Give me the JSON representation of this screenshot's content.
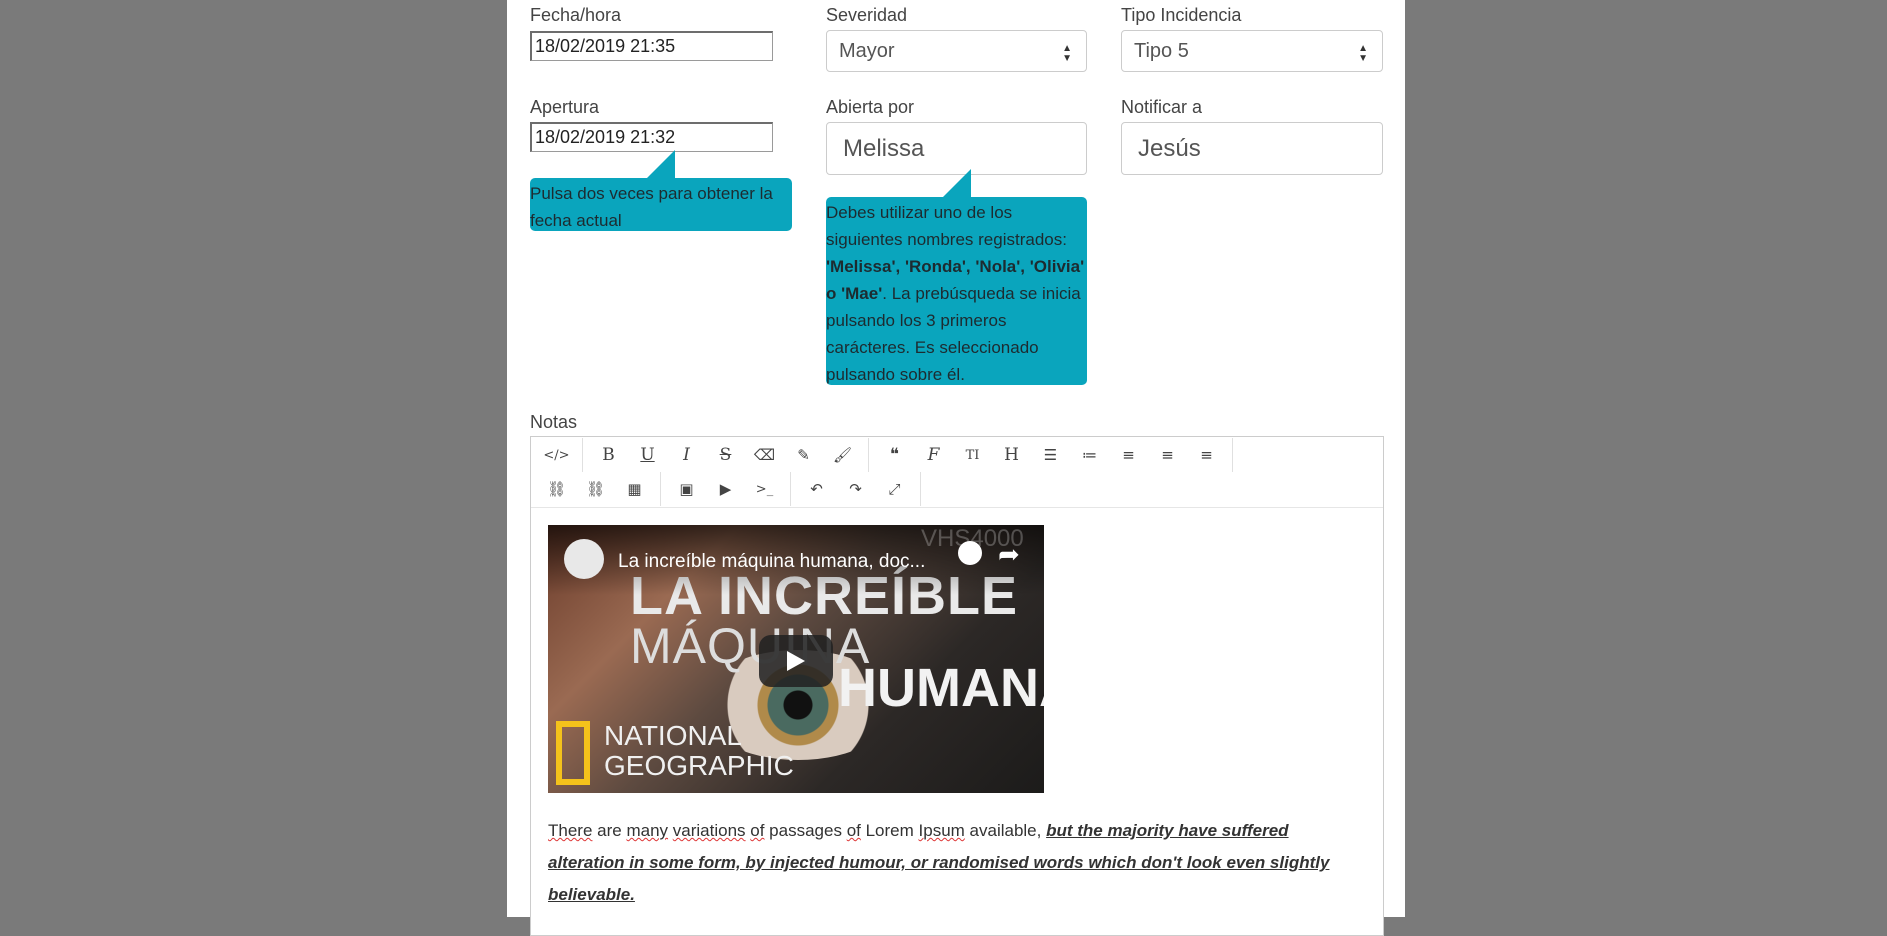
{
  "form": {
    "fecha": {
      "label": "Fecha/hora",
      "value": "18/02/2019 21:35"
    },
    "severidad": {
      "label": "Severidad",
      "value": "Mayor"
    },
    "tipo": {
      "label": "Tipo Incidencia",
      "value": "Tipo 5"
    },
    "apertura": {
      "label": "Apertura",
      "value": "18/02/2019 21:32"
    },
    "abierta_por": {
      "label": "Abierta por",
      "value": "Melissa"
    },
    "notificar": {
      "label": "Notificar a",
      "value": "Jesús"
    },
    "tooltip_apertura": "Pulsa dos veces para obtener la fecha actual",
    "tooltip_abierta": {
      "intro": "Debes utilizar uno de los siguientes nombres registrados:",
      "names": "'Melissa', 'Ronda', 'Nola', 'Olivia' o 'Mae'",
      "rest": ". La prebúsqueda se inicia pulsando los 3 primeros carácteres. Es seleccionado pulsando sobre él."
    },
    "notas_label": "Notas"
  },
  "toolbar": {
    "row1": [
      [
        "code-view-icon"
      ],
      [
        "bold-icon",
        "underline-icon",
        "italic-icon",
        "strikethrough-icon",
        "eraser-icon",
        "pencil-icon",
        "brush-icon"
      ],
      [
        "blockquote-icon",
        "font-icon",
        "text-size-icon",
        "heading-icon",
        "unordered-list-icon",
        "ordered-list-icon",
        "align-left-icon",
        "align-center-icon",
        "align-right-icon"
      ]
    ],
    "row2": [
      [
        "link-icon",
        "unlink-icon",
        "table-icon"
      ],
      [
        "image-icon",
        "video-icon",
        "terminal-icon"
      ],
      [
        "undo-icon",
        "redo-icon",
        "fullscreen-icon"
      ]
    ]
  },
  "video": {
    "title": "La increíble máquina humana, doc...",
    "headline1": "LA INCREÍBLE",
    "headline2": "MÁQUINA",
    "headline3": "HUMANA",
    "brand1": "NATIONAL",
    "brand2": "GEOGRAPHIC",
    "watermark": "VHS4000"
  },
  "content": {
    "plain": [
      "There",
      " are ",
      "many",
      " ",
      "variations",
      " ",
      "of",
      " passages ",
      "of",
      " Lorem ",
      "Ipsum",
      " available, "
    ],
    "bold": "but the majority have suffered alteration in some form, by injected humour, or randomised words which don't look even slightly believable."
  }
}
